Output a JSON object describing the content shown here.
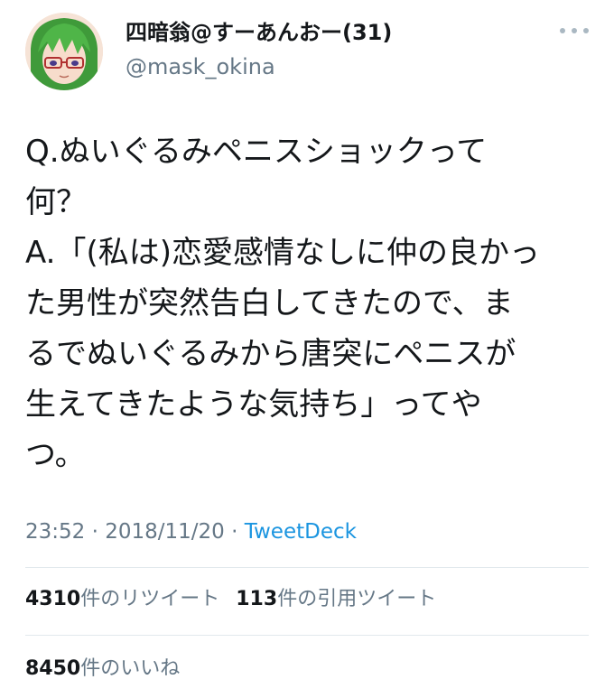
{
  "user": {
    "display_name": "四暗翁@すーあんおー(31)",
    "handle": "@mask_okina"
  },
  "more_icon": "more-horizontal-icon",
  "tweet": {
    "text": "Q.ぬいぐるみペニスショックって\n何？\nA.「(私は)恋愛感情なしに仲の良かっ\nた男性が突然告白してきたので、ま\nるでぬいぐるみから唐突にペニスが\n生えてきたような気持ち」ってや\nつ。"
  },
  "meta": {
    "time": "23:52",
    "sep1": " · ",
    "date": "2018/11/20",
    "sep2": " · ",
    "source": "TweetDeck"
  },
  "stats": {
    "retweets_count": "4310",
    "retweets_label": "件のリツイート",
    "quotes_count": "113",
    "quotes_label": "件の引用ツイート",
    "likes_count": "8450",
    "likes_label": "件のいいね"
  },
  "colors": {
    "text": "#14171a",
    "secondary": "#657786",
    "link": "#1b95e0",
    "divider": "#e1e8ed"
  }
}
